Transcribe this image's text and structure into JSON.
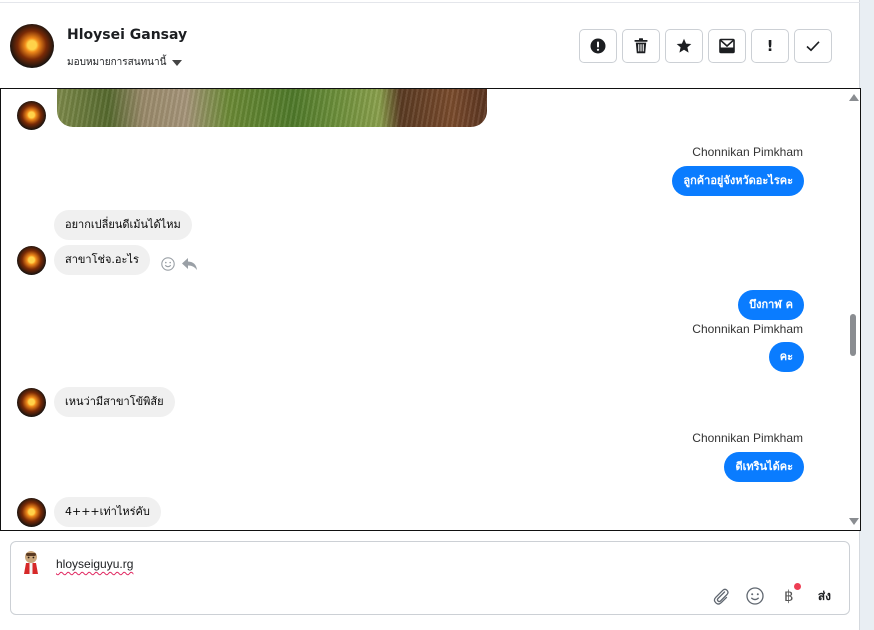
{
  "header": {
    "contact_name": "Hloysei Gansay",
    "assign_label": "มอบหมายการสนทนานี้"
  },
  "actions": {
    "important_icon": "exclamation-circle-icon",
    "delete_icon": "trash-icon",
    "star_icon": "star-icon",
    "archive_icon": "envelope-archive-icon",
    "flag_label": "!",
    "done_icon": "check-icon"
  },
  "messages": {
    "m1_sender": "Chonnikan Pimkham",
    "m1_text": "ลูกค้าอยู่จังหวัดอะไรคะ",
    "m2_text": "อยากเปลี่ยนดีเม้นได้ไหม",
    "m3_text": "สาขาโช่จ.อะไร",
    "m4_text": "บึงกาฬ ค",
    "m5_sender": "Chonnikan Pimkham",
    "m5_text": "คะ",
    "m6_text": "เหนว่ามีสาขาโข้พิส้ย",
    "m7_sender": "Chonnikan Pimkham",
    "m7_text": "ดีเทรินได้คะ",
    "m8_text": "4+++เท่าไหร่คับ"
  },
  "composer": {
    "text": "hloyseiguyu.rg",
    "send_label": "ส่ง",
    "currency_symbol": "฿"
  },
  "colors": {
    "outgoing_bubble": "#0a7cff",
    "incoming_bubble": "#f0f0f0",
    "badge_dot": "#ee3e54"
  }
}
